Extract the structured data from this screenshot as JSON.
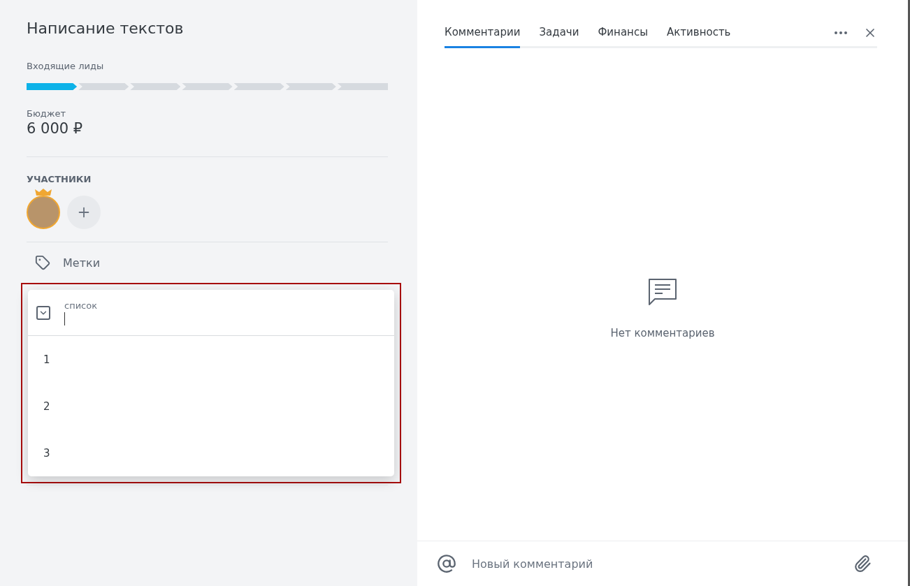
{
  "deal": {
    "title": "Написание текстов",
    "stage_name": "Входящие лиды",
    "stages": [
      {
        "selected": true
      },
      {
        "selected": false
      },
      {
        "selected": false
      },
      {
        "selected": false
      },
      {
        "selected": false
      },
      {
        "selected": false
      },
      {
        "selected": false
      }
    ],
    "budget_label": "Бюджет",
    "budget_value": "6 000 ₽",
    "participants_label": "УЧАСТНИКИ",
    "participants": [
      {
        "owner": true
      }
    ],
    "tags_label": "Метки"
  },
  "dropdown": {
    "highlighted": true,
    "label": "список",
    "options": [
      "1",
      "2",
      "3"
    ]
  },
  "panel": {
    "tabs": [
      {
        "label": "Комментарии",
        "selected": true
      },
      {
        "label": "Задачи",
        "selected": false
      },
      {
        "label": "Финансы",
        "selected": false
      },
      {
        "label": "Активность",
        "selected": false
      }
    ],
    "empty_text": "Нет комментариев",
    "comment_placeholder": "Новый комментарий"
  }
}
